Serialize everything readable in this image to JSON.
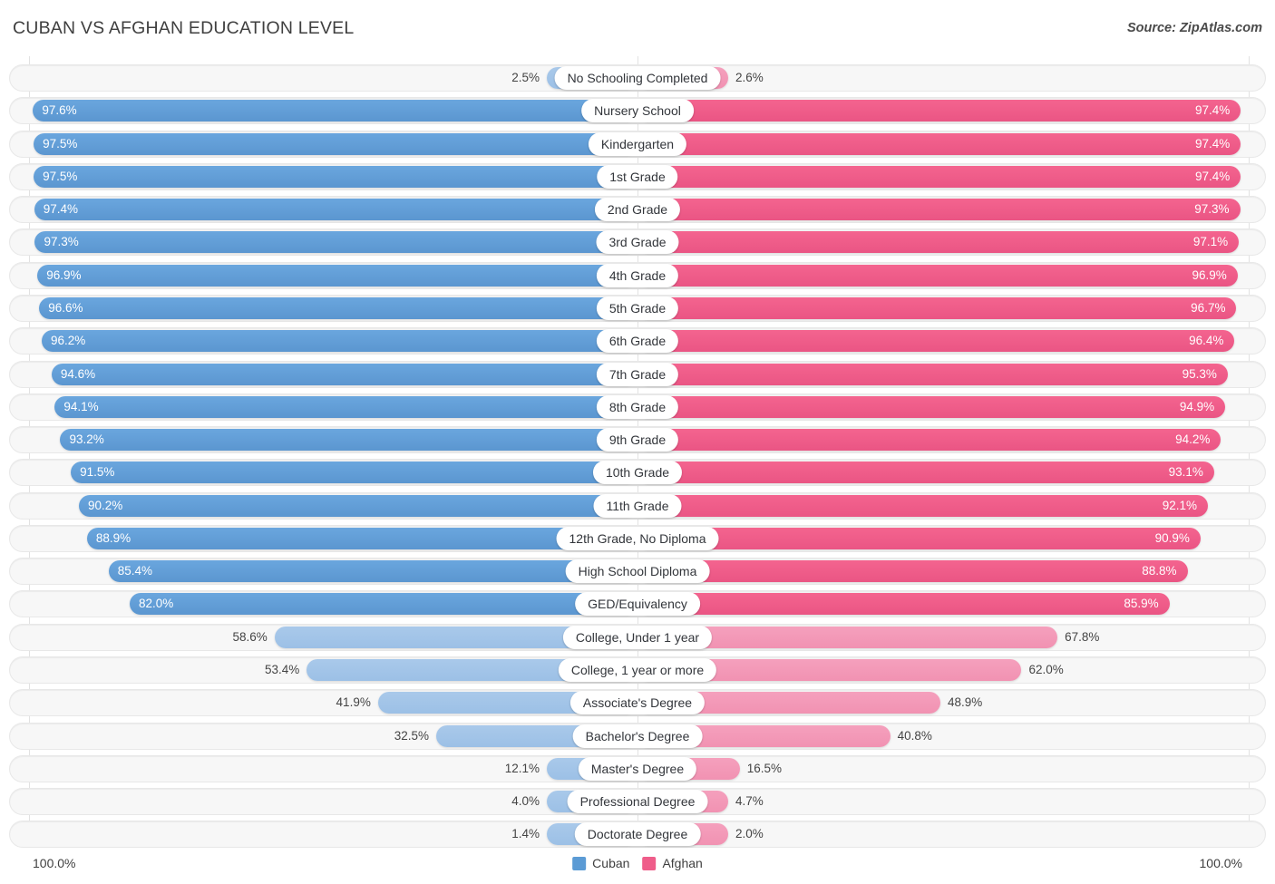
{
  "header": {
    "title": "CUBAN VS AFGHAN EDUCATION LEVEL",
    "source": "Source: ZipAtlas.com"
  },
  "footer": {
    "axis_left": "100.0%",
    "axis_right": "100.0%",
    "legend": [
      {
        "label": "Cuban",
        "color": "#5b9bd5"
      },
      {
        "label": "Afghan",
        "color": "#ef5d8a"
      }
    ]
  },
  "colors": {
    "cuban": "#5b9bd5",
    "cuban_pale": "#a2c5e8",
    "afghan": "#ef5d8a",
    "afghan_pale": "#f39bb8",
    "track": "#f7f7f7",
    "gridline": "#e2e2e2"
  },
  "chart_data": {
    "type": "bar",
    "orientation": "horizontal-diverging",
    "title": "CUBAN VS AFGHAN EDUCATION LEVEL",
    "xlabel": "",
    "ylabel": "",
    "xlim": [
      100.0,
      100.0
    ],
    "grid": true,
    "legend_position": "bottom-center",
    "unit": "%",
    "categories": [
      "No Schooling Completed",
      "Nursery School",
      "Kindergarten",
      "1st Grade",
      "2nd Grade",
      "3rd Grade",
      "4th Grade",
      "5th Grade",
      "6th Grade",
      "7th Grade",
      "8th Grade",
      "9th Grade",
      "10th Grade",
      "11th Grade",
      "12th Grade, No Diploma",
      "High School Diploma",
      "GED/Equivalency",
      "College, Under 1 year",
      "College, 1 year or more",
      "Associate's Degree",
      "Bachelor's Degree",
      "Master's Degree",
      "Professional Degree",
      "Doctorate Degree"
    ],
    "series": [
      {
        "name": "Cuban",
        "color": "#5b9bd5",
        "values": [
          2.5,
          97.6,
          97.5,
          97.5,
          97.4,
          97.3,
          96.9,
          96.6,
          96.2,
          94.6,
          94.1,
          93.2,
          91.5,
          90.2,
          88.9,
          85.4,
          82.0,
          58.6,
          53.4,
          41.9,
          32.5,
          12.1,
          4.0,
          1.4
        ],
        "labels": [
          "2.5%",
          "97.6%",
          "97.5%",
          "97.5%",
          "97.4%",
          "97.3%",
          "96.9%",
          "96.6%",
          "96.2%",
          "94.6%",
          "94.1%",
          "93.2%",
          "91.5%",
          "90.2%",
          "88.9%",
          "85.4%",
          "82.0%",
          "58.6%",
          "53.4%",
          "41.9%",
          "32.5%",
          "12.1%",
          "4.0%",
          "1.4%"
        ]
      },
      {
        "name": "Afghan",
        "color": "#ef5d8a",
        "values": [
          2.6,
          97.4,
          97.4,
          97.4,
          97.3,
          97.1,
          96.9,
          96.7,
          96.4,
          95.3,
          94.9,
          94.2,
          93.1,
          92.1,
          90.9,
          88.8,
          85.9,
          67.8,
          62.0,
          48.9,
          40.8,
          16.5,
          4.7,
          2.0
        ],
        "labels": [
          "2.6%",
          "97.4%",
          "97.4%",
          "97.4%",
          "97.3%",
          "97.1%",
          "96.9%",
          "96.7%",
          "96.4%",
          "95.3%",
          "94.9%",
          "94.2%",
          "93.1%",
          "92.1%",
          "90.9%",
          "88.8%",
          "85.9%",
          "67.8%",
          "62.0%",
          "48.9%",
          "40.8%",
          "16.5%",
          "4.7%",
          "2.0%"
        ]
      }
    ]
  }
}
